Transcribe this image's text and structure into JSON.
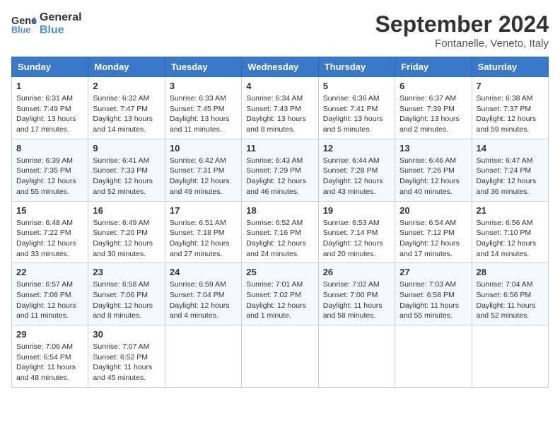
{
  "header": {
    "logo_general": "General",
    "logo_blue": "Blue",
    "month_title": "September 2024",
    "location": "Fontanelle, Veneto, Italy"
  },
  "days_of_week": [
    "Sunday",
    "Monday",
    "Tuesday",
    "Wednesday",
    "Thursday",
    "Friday",
    "Saturday"
  ],
  "weeks": [
    [
      {
        "day": "1",
        "sunrise": "6:31 AM",
        "sunset": "7:49 PM",
        "daylight": "13 hours and 17 minutes."
      },
      {
        "day": "2",
        "sunrise": "6:32 AM",
        "sunset": "7:47 PM",
        "daylight": "13 hours and 14 minutes."
      },
      {
        "day": "3",
        "sunrise": "6:33 AM",
        "sunset": "7:45 PM",
        "daylight": "13 hours and 11 minutes."
      },
      {
        "day": "4",
        "sunrise": "6:34 AM",
        "sunset": "7:43 PM",
        "daylight": "13 hours and 8 minutes."
      },
      {
        "day": "5",
        "sunrise": "6:36 AM",
        "sunset": "7:41 PM",
        "daylight": "13 hours and 5 minutes."
      },
      {
        "day": "6",
        "sunrise": "6:37 AM",
        "sunset": "7:39 PM",
        "daylight": "13 hours and 2 minutes."
      },
      {
        "day": "7",
        "sunrise": "6:38 AM",
        "sunset": "7:37 PM",
        "daylight": "12 hours and 59 minutes."
      }
    ],
    [
      {
        "day": "8",
        "sunrise": "6:39 AM",
        "sunset": "7:35 PM",
        "daylight": "12 hours and 55 minutes."
      },
      {
        "day": "9",
        "sunrise": "6:41 AM",
        "sunset": "7:33 PM",
        "daylight": "12 hours and 52 minutes."
      },
      {
        "day": "10",
        "sunrise": "6:42 AM",
        "sunset": "7:31 PM",
        "daylight": "12 hours and 49 minutes."
      },
      {
        "day": "11",
        "sunrise": "6:43 AM",
        "sunset": "7:29 PM",
        "daylight": "12 hours and 46 minutes."
      },
      {
        "day": "12",
        "sunrise": "6:44 AM",
        "sunset": "7:28 PM",
        "daylight": "12 hours and 43 minutes."
      },
      {
        "day": "13",
        "sunrise": "6:46 AM",
        "sunset": "7:26 PM",
        "daylight": "12 hours and 40 minutes."
      },
      {
        "day": "14",
        "sunrise": "6:47 AM",
        "sunset": "7:24 PM",
        "daylight": "12 hours and 36 minutes."
      }
    ],
    [
      {
        "day": "15",
        "sunrise": "6:48 AM",
        "sunset": "7:22 PM",
        "daylight": "12 hours and 33 minutes."
      },
      {
        "day": "16",
        "sunrise": "6:49 AM",
        "sunset": "7:20 PM",
        "daylight": "12 hours and 30 minutes."
      },
      {
        "day": "17",
        "sunrise": "6:51 AM",
        "sunset": "7:18 PM",
        "daylight": "12 hours and 27 minutes."
      },
      {
        "day": "18",
        "sunrise": "6:52 AM",
        "sunset": "7:16 PM",
        "daylight": "12 hours and 24 minutes."
      },
      {
        "day": "19",
        "sunrise": "6:53 AM",
        "sunset": "7:14 PM",
        "daylight": "12 hours and 20 minutes."
      },
      {
        "day": "20",
        "sunrise": "6:54 AM",
        "sunset": "7:12 PM",
        "daylight": "12 hours and 17 minutes."
      },
      {
        "day": "21",
        "sunrise": "6:56 AM",
        "sunset": "7:10 PM",
        "daylight": "12 hours and 14 minutes."
      }
    ],
    [
      {
        "day": "22",
        "sunrise": "6:57 AM",
        "sunset": "7:08 PM",
        "daylight": "12 hours and 11 minutes."
      },
      {
        "day": "23",
        "sunrise": "6:58 AM",
        "sunset": "7:06 PM",
        "daylight": "12 hours and 8 minutes."
      },
      {
        "day": "24",
        "sunrise": "6:59 AM",
        "sunset": "7:04 PM",
        "daylight": "12 hours and 4 minutes."
      },
      {
        "day": "25",
        "sunrise": "7:01 AM",
        "sunset": "7:02 PM",
        "daylight": "12 hours and 1 minute."
      },
      {
        "day": "26",
        "sunrise": "7:02 AM",
        "sunset": "7:00 PM",
        "daylight": "11 hours and 58 minutes."
      },
      {
        "day": "27",
        "sunrise": "7:03 AM",
        "sunset": "6:58 PM",
        "daylight": "11 hours and 55 minutes."
      },
      {
        "day": "28",
        "sunrise": "7:04 AM",
        "sunset": "6:56 PM",
        "daylight": "11 hours and 52 minutes."
      }
    ],
    [
      {
        "day": "29",
        "sunrise": "7:06 AM",
        "sunset": "6:54 PM",
        "daylight": "11 hours and 48 minutes."
      },
      {
        "day": "30",
        "sunrise": "7:07 AM",
        "sunset": "6:52 PM",
        "daylight": "11 hours and 45 minutes."
      },
      null,
      null,
      null,
      null,
      null
    ]
  ]
}
